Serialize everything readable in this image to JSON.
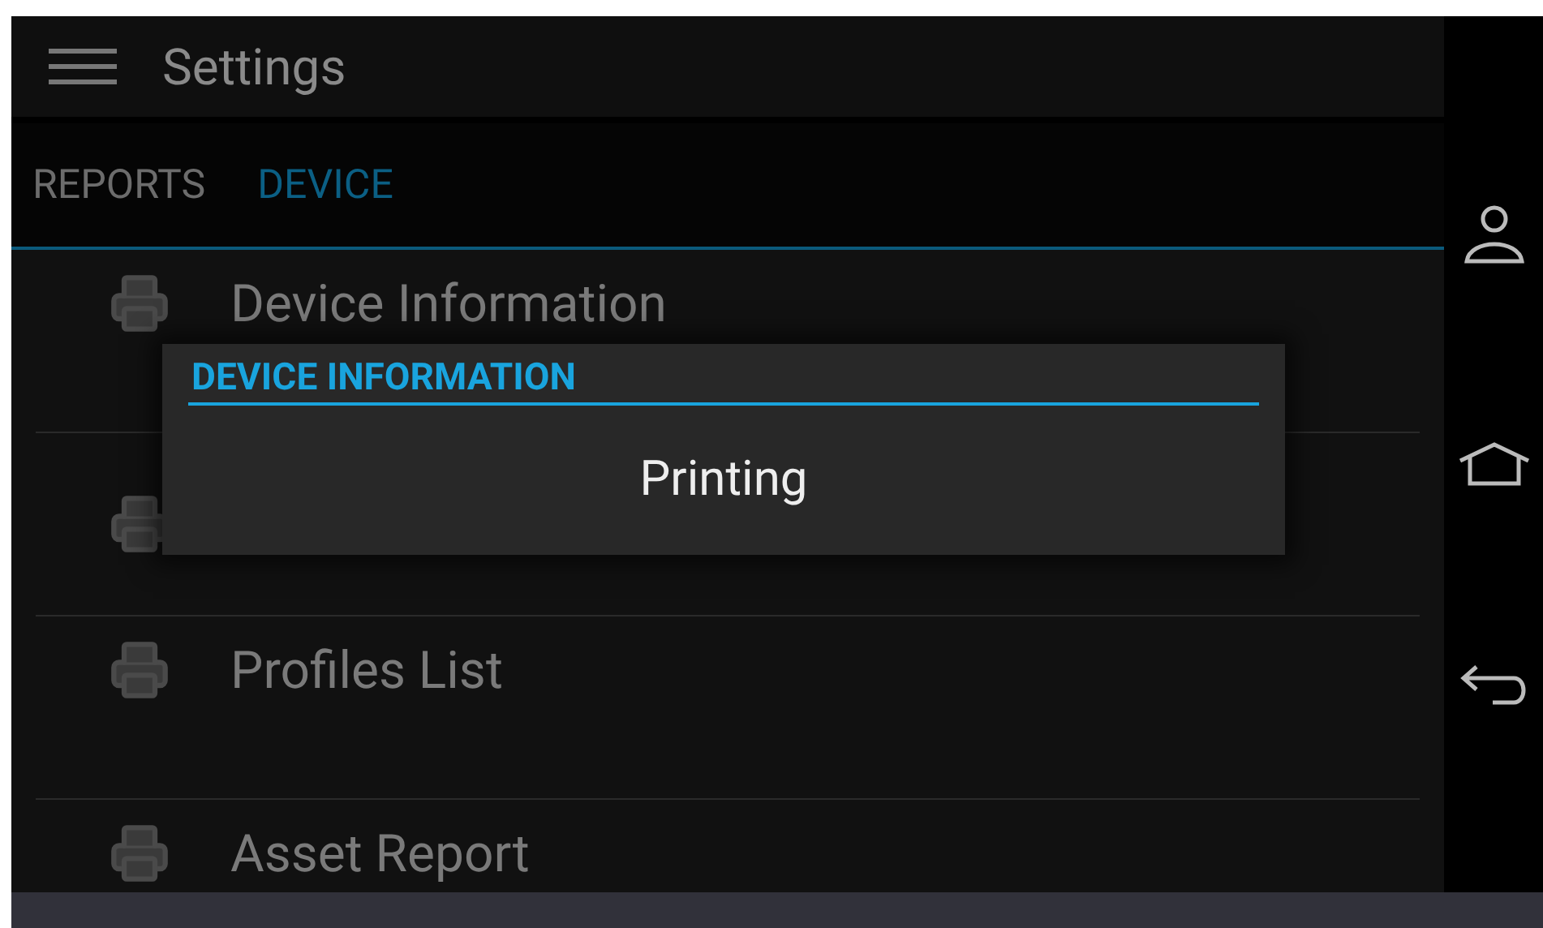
{
  "app_bar": {
    "title": "Settings"
  },
  "tabs": [
    {
      "label": "REPORTS",
      "selected": false
    },
    {
      "label": "DEVICE",
      "selected": true
    }
  ],
  "list": {
    "items": [
      {
        "kind": "entry",
        "label": "Device Information"
      },
      {
        "kind": "covered"
      },
      {
        "kind": "entry",
        "label": "Profiles List"
      },
      {
        "kind": "entry",
        "label": "Asset Report"
      }
    ]
  },
  "dialog": {
    "title": "DEVICE INFORMATION",
    "message": "Printing"
  }
}
